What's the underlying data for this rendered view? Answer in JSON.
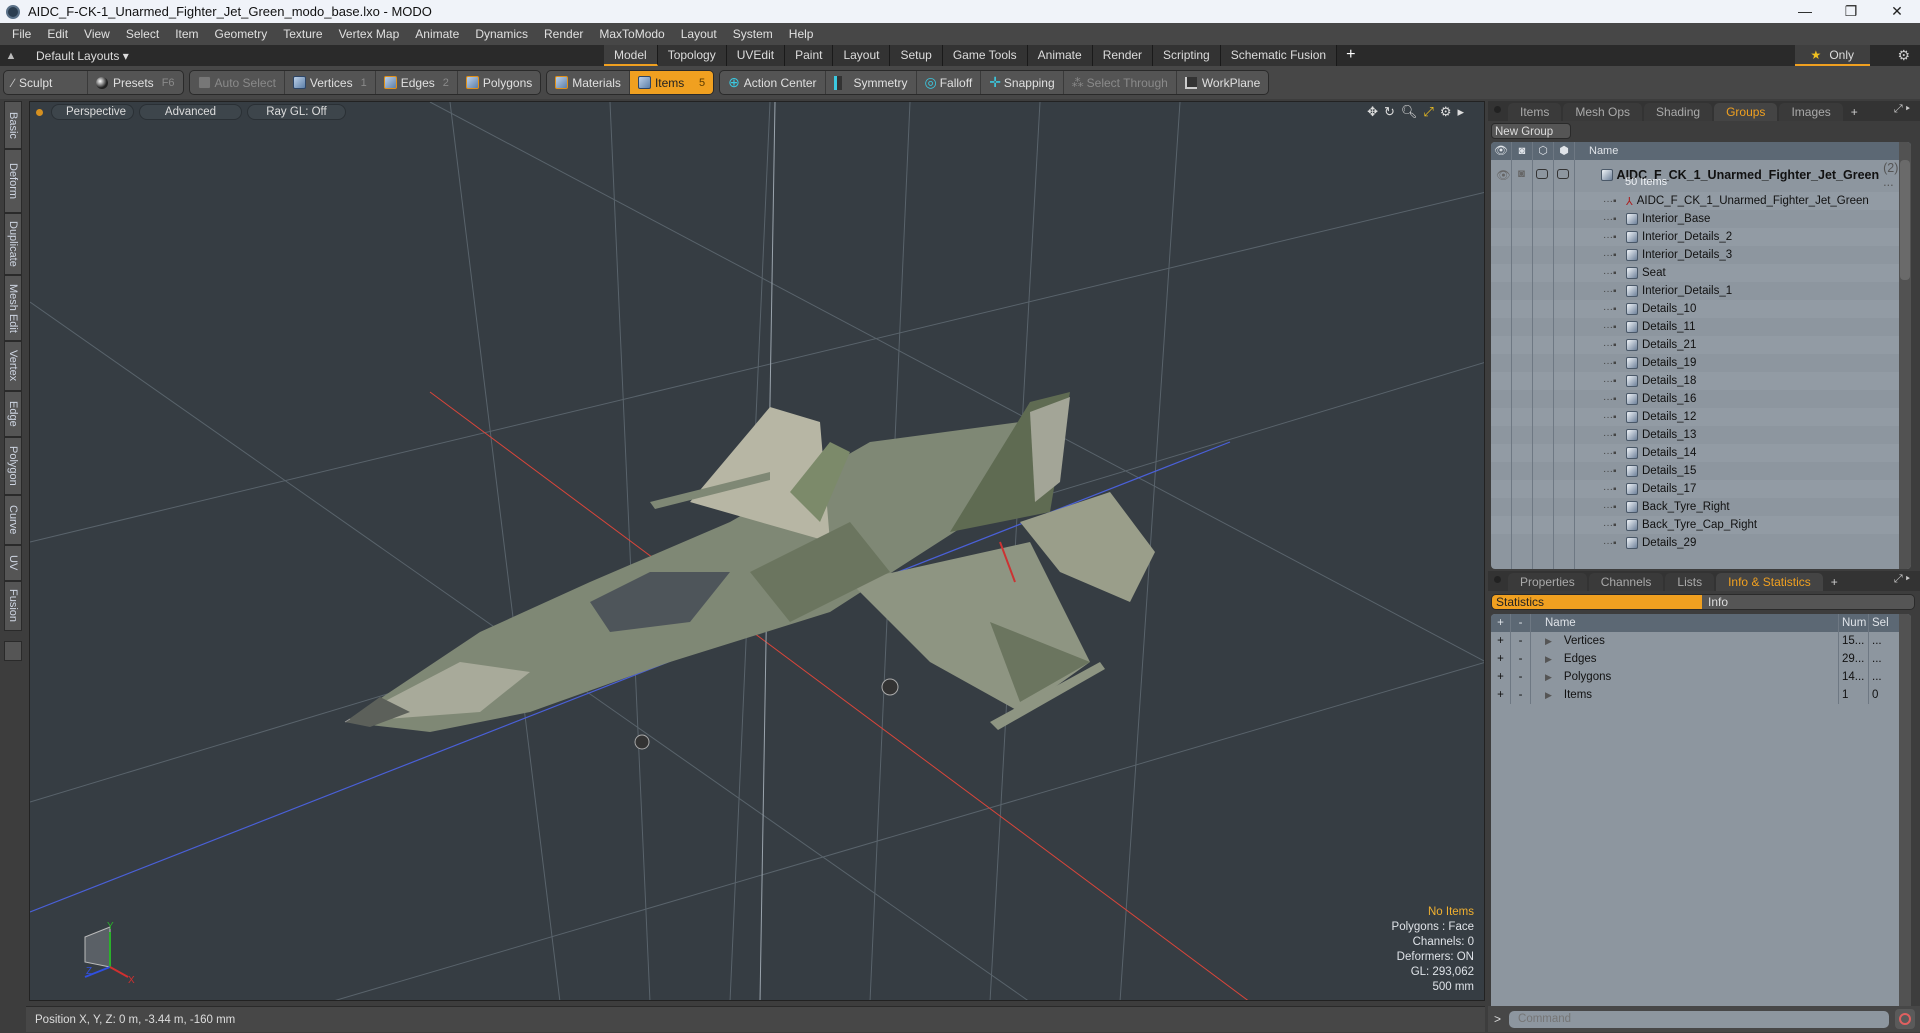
{
  "window": {
    "title": "AIDC_F-CK-1_Unarmed_Fighter_Jet_Green_modo_base.lxo - MODO",
    "controls": {
      "minimize": "—",
      "maximize": "❐",
      "close": "✕"
    }
  },
  "menu": [
    "File",
    "Edit",
    "View",
    "Select",
    "Item",
    "Geometry",
    "Texture",
    "Vertex Map",
    "Animate",
    "Dynamics",
    "Render",
    "MaxToModo",
    "Layout",
    "System",
    "Help"
  ],
  "layoutbar": {
    "layouts_label": "Default Layouts ▾",
    "tabs": [
      "Model",
      "Topology",
      "UVEdit",
      "Paint",
      "Layout",
      "Setup",
      "Game Tools",
      "Animate",
      "Render",
      "Scripting",
      "Schematic Fusion"
    ],
    "active_tab": "Model",
    "add": "+",
    "only_label": "Only",
    "star": "★",
    "gear": "⚙"
  },
  "toolbar": {
    "sculpt": "Sculpt",
    "presets": "Presets",
    "presets_key": "F6",
    "auto_select": "Auto Select",
    "vertices": "Vertices",
    "vertices_key": "1",
    "edges": "Edges",
    "edges_key": "2",
    "polygons": "Polygons",
    "materials": "Materials",
    "items": "Items",
    "items_key": "5",
    "action_center": "Action Center",
    "symmetry": "Symmetry",
    "falloff": "Falloff",
    "snapping": "Snapping",
    "select_through": "Select Through",
    "workplane": "WorkPlane"
  },
  "side_tabs": [
    "Basic",
    "Deform",
    "Duplicate",
    "Mesh Edit",
    "Vertex",
    "Edge",
    "Polygon",
    "Curve",
    "UV",
    "Fusion"
  ],
  "viewport": {
    "view": "Perspective",
    "shading": "Advanced",
    "raygl": "Ray GL: Off",
    "stats": {
      "selection": "No Items",
      "polygons": "Polygons : Face",
      "channels": "Channels: 0",
      "deformers": "Deformers: ON",
      "gl": "GL: 293,062",
      "grid": "500 mm"
    },
    "axis_labels": {
      "x": "X",
      "y": "Y",
      "z": "Z"
    },
    "colors": {
      "bg": "#363d43",
      "x_axis": "#d9453a",
      "z_axis": "#4a60d8",
      "jet_light": "#a9ab99",
      "jet_dark": "#6b755f"
    }
  },
  "status": {
    "position": "Position X, Y, Z:   0 m, -3.44 m, -160 mm"
  },
  "groups_panel": {
    "tabs": [
      "Items",
      "Mesh Ops",
      "Shading",
      "Groups",
      "Images"
    ],
    "active_tab": "Groups",
    "new_group": "New Group",
    "column_name": "Name",
    "root": {
      "name": "AIDC_F_CK_1_Unarmed_Fighter_Jet_Green",
      "count": "(2) ...",
      "sub": "50 Items"
    },
    "items": [
      {
        "name": "AIDC_F_CK_1_Unarmed_Fighter_Jet_Green",
        "type": "locator"
      },
      {
        "name": "Interior_Base",
        "type": "mesh"
      },
      {
        "name": "Interior_Details_2",
        "type": "mesh"
      },
      {
        "name": "Interior_Details_3",
        "type": "mesh"
      },
      {
        "name": "Seat",
        "type": "mesh"
      },
      {
        "name": "Interior_Details_1",
        "type": "mesh"
      },
      {
        "name": "Details_10",
        "type": "mesh"
      },
      {
        "name": "Details_11",
        "type": "mesh"
      },
      {
        "name": "Details_21",
        "type": "mesh"
      },
      {
        "name": "Details_19",
        "type": "mesh"
      },
      {
        "name": "Details_18",
        "type": "mesh"
      },
      {
        "name": "Details_16",
        "type": "mesh"
      },
      {
        "name": "Details_12",
        "type": "mesh"
      },
      {
        "name": "Details_13",
        "type": "mesh"
      },
      {
        "name": "Details_14",
        "type": "mesh"
      },
      {
        "name": "Details_15",
        "type": "mesh"
      },
      {
        "name": "Details_17",
        "type": "mesh"
      },
      {
        "name": "Back_Tyre_Right",
        "type": "mesh"
      },
      {
        "name": "Back_Tyre_Cap_Right",
        "type": "mesh"
      },
      {
        "name": "Details_29",
        "type": "mesh"
      }
    ]
  },
  "stats_panel": {
    "tabs": [
      "Properties",
      "Channels",
      "Lists",
      "Info & Statistics"
    ],
    "active_tab": "Info & Statistics",
    "switch": {
      "statistics": "Statistics",
      "info": "Info"
    },
    "columns": {
      "plus": "+",
      "minus": "-",
      "name": "Name",
      "num": "Num",
      "sel": "Sel"
    },
    "rows": [
      {
        "name": "Vertices",
        "num": "15...",
        "sel": "..."
      },
      {
        "name": "Edges",
        "num": "29...",
        "sel": "..."
      },
      {
        "name": "Polygons",
        "num": "14...",
        "sel": "..."
      },
      {
        "name": "Items",
        "num": "1",
        "sel": "0"
      }
    ]
  },
  "command": {
    "prompt": ">",
    "placeholder": "Command"
  }
}
